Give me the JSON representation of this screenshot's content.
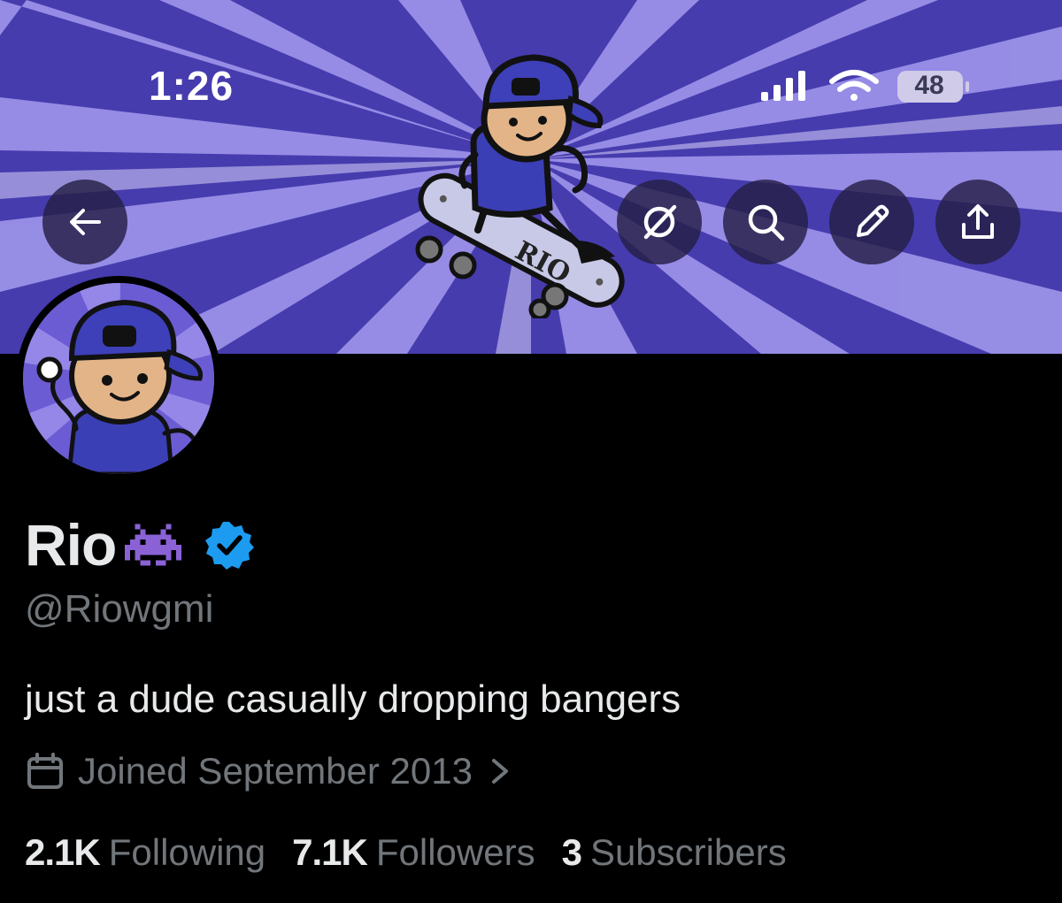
{
  "status_bar": {
    "time": "1:26",
    "battery": "48",
    "icons": [
      "signal-icon",
      "wifi-icon",
      "battery-icon"
    ]
  },
  "header_buttons": [
    {
      "name": "back-arrow-icon"
    },
    {
      "name": "grok-icon"
    },
    {
      "name": "search-icon"
    },
    {
      "name": "edit-pencil-icon"
    },
    {
      "name": "share-icon"
    }
  ],
  "banner": {
    "skateboard_text": "RIO",
    "colors": {
      "ray_dark": "#4a3fb3",
      "ray_light": "#a89cf0",
      "shirt": "#3b3fb5",
      "skin": "#e2b488"
    }
  },
  "profile": {
    "display_name": "Rio",
    "emoji": "alien-monster-icon",
    "verified": true,
    "handle": "@Riowgmi",
    "bio": "just a dude casually dropping bangers",
    "joined": "Joined September 2013"
  },
  "stats": {
    "following_count": "2.1K",
    "following_label": "Following",
    "followers_count": "7.1K",
    "followers_label": "Followers",
    "subscribers_count": "3",
    "subscribers_label": "Subscribers"
  },
  "colors": {
    "background": "#000000",
    "primary_text": "#e7e9ea",
    "secondary_text": "#71767b",
    "verified_blue": "#1d9bf0"
  }
}
